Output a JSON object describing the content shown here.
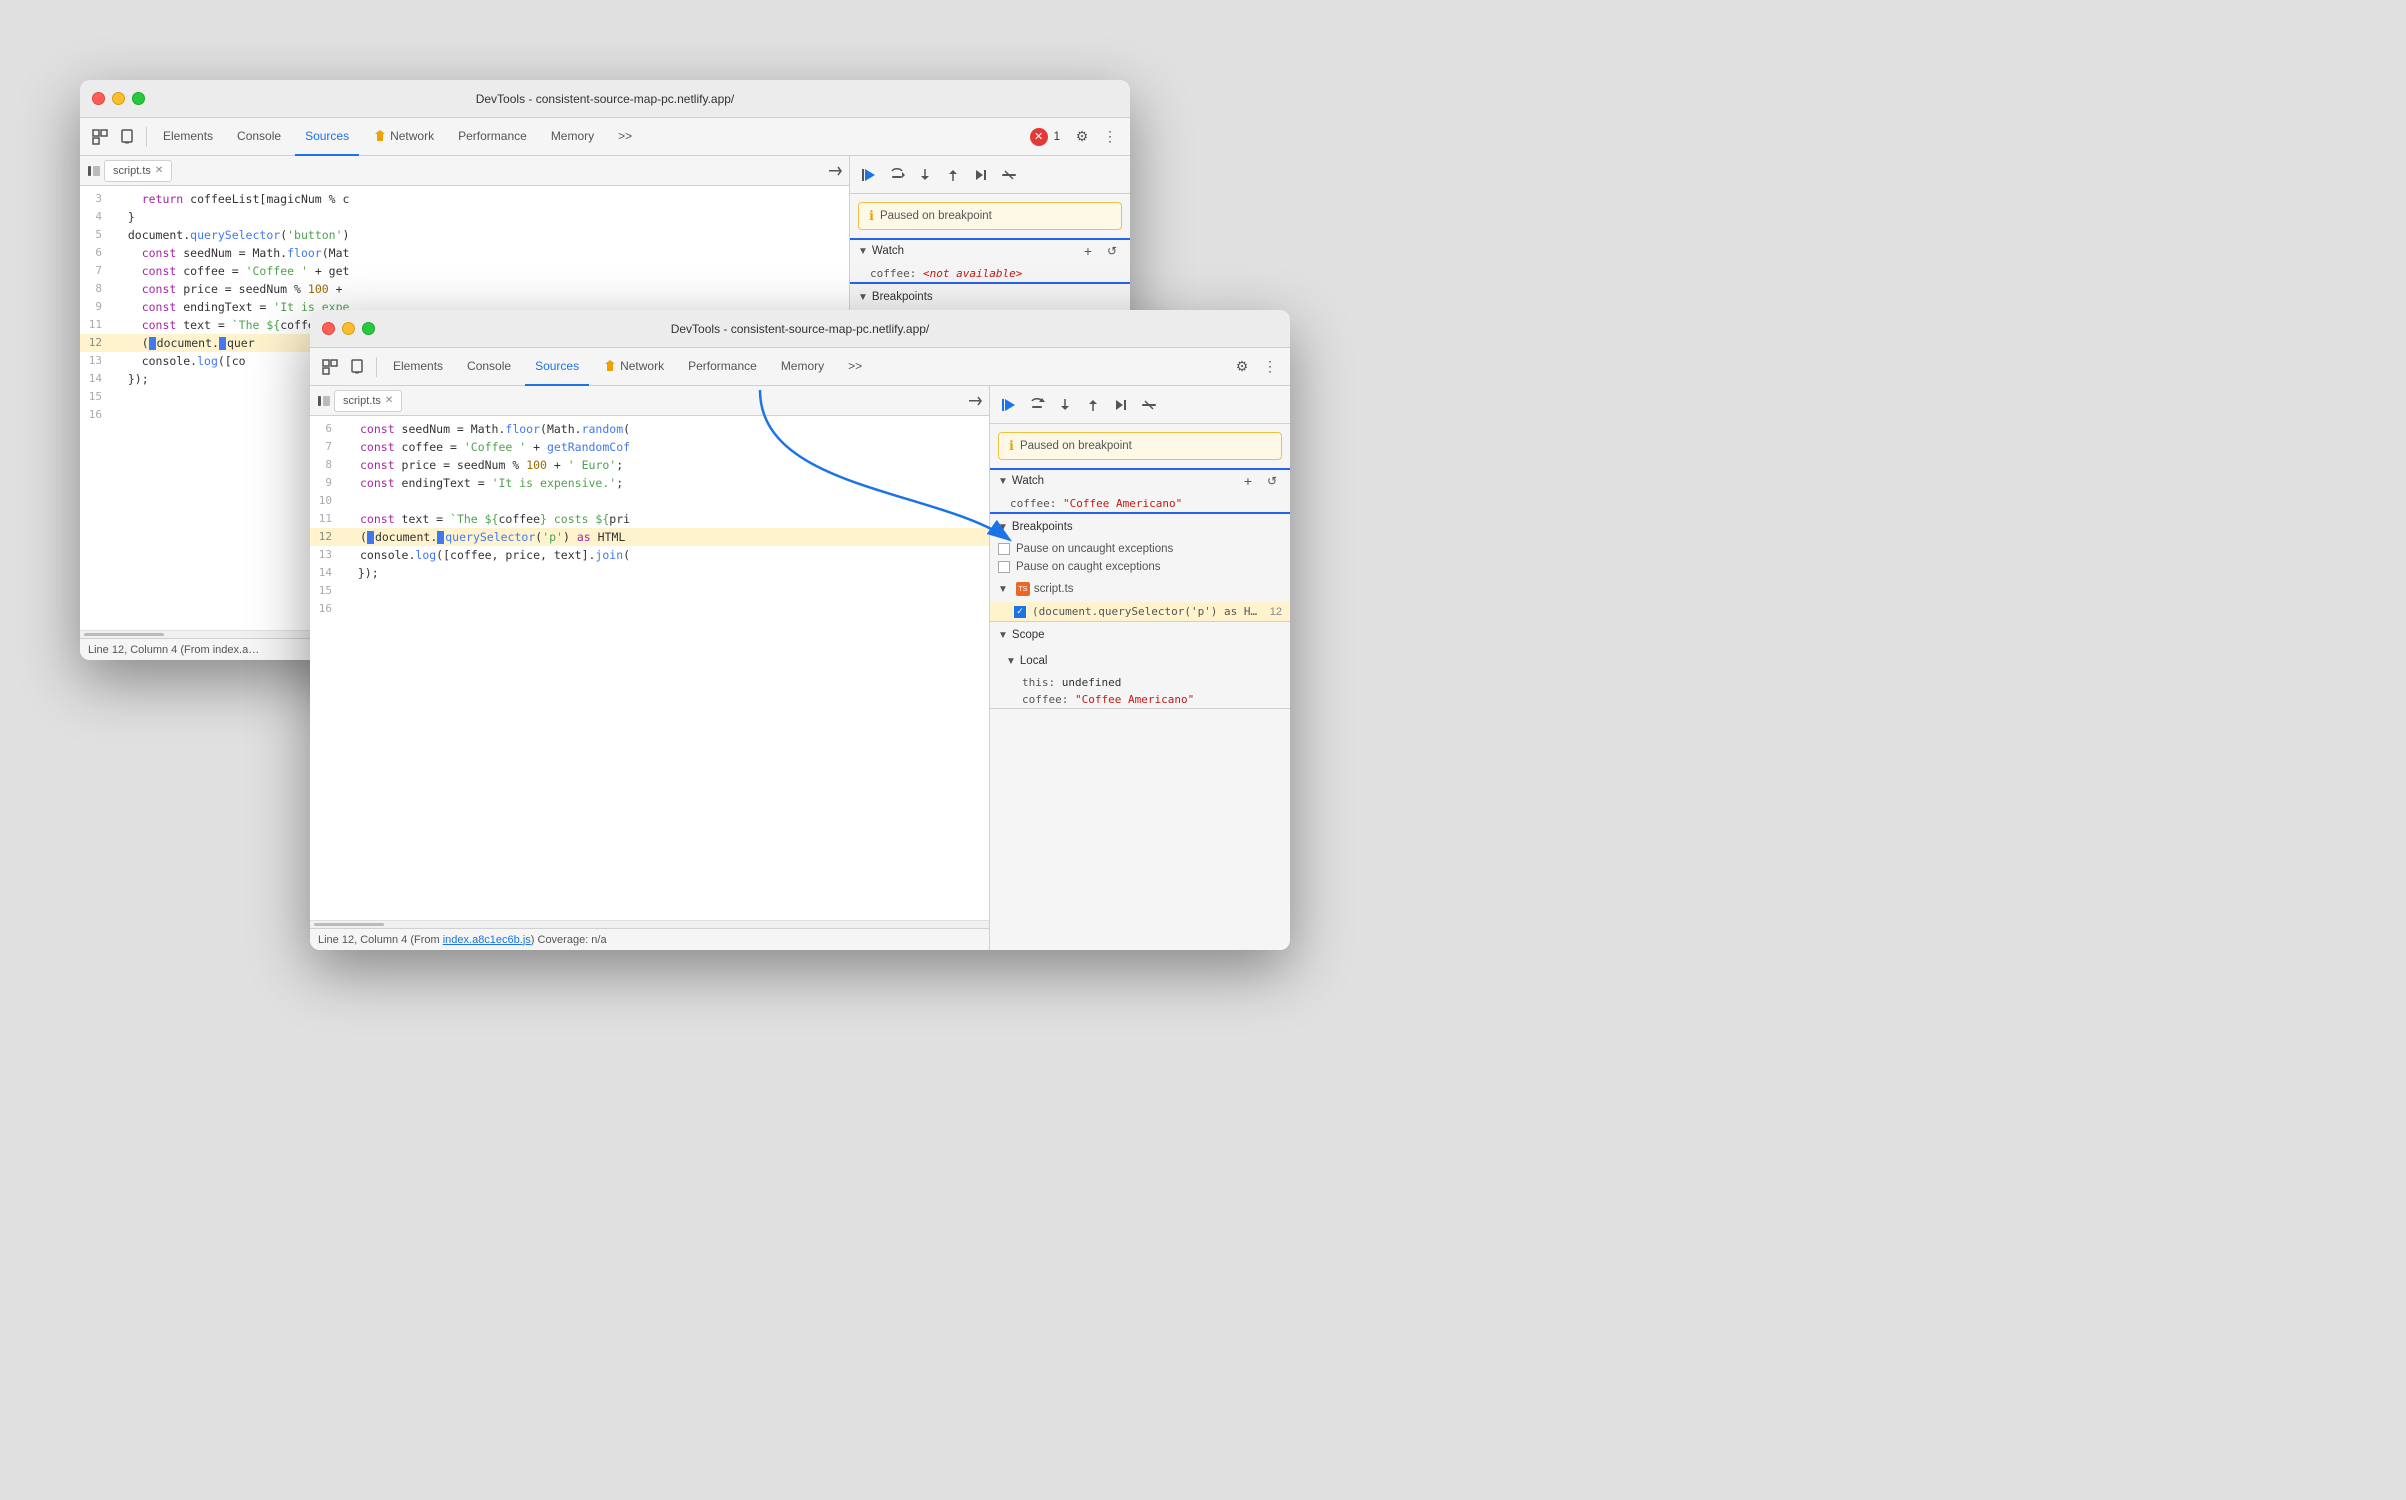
{
  "windows": {
    "back": {
      "title": "DevTools - consistent-source-map-pc.netlify.app/",
      "filename": "script.ts",
      "tabs": [
        "Elements",
        "Console",
        "Sources",
        "Network",
        "Performance",
        "Memory"
      ],
      "activeTab": "Sources",
      "statusBar": "Line 12, Column 4 (From index.a…",
      "pausedText": "Paused on breakpoint",
      "codeLines": [
        {
          "num": 3,
          "content": "    return coffeeList[magicNum % c"
        },
        {
          "num": 4,
          "content": "  }"
        },
        {
          "num": 5,
          "content": "  document.querySelector('button')"
        },
        {
          "num": 6,
          "content": "    const seedNum = Math.floor(Mat"
        },
        {
          "num": 7,
          "content": "    const coffee = 'Coffee ' + get"
        },
        {
          "num": 8,
          "content": "    const price = seedNum % 100 +"
        },
        {
          "num": 9,
          "content": "    const endingText = 'It is expe"
        },
        {
          "num": 11,
          "content": "    const text = `The ${coffee} co"
        },
        {
          "num": 12,
          "content": "    (document.querySelector",
          "highlighted": true
        },
        {
          "num": 13,
          "content": "    console.log([co"
        },
        {
          "num": 14,
          "content": "  });"
        },
        {
          "num": 15,
          "content": ""
        },
        {
          "num": 16,
          "content": ""
        }
      ],
      "watch": {
        "label": "Watch",
        "items": [
          {
            "key": "coffee",
            "value": "<not available>",
            "type": "unavailable"
          }
        ]
      },
      "breakpoints": {
        "label": "Breakpoints",
        "items": []
      }
    },
    "front": {
      "title": "DevTools - consistent-source-map-pc.netlify.app/",
      "filename": "script.ts",
      "tabs": [
        "Elements",
        "Console",
        "Sources",
        "Network",
        "Performance",
        "Memory"
      ],
      "activeTab": "Sources",
      "statusBar": "Line 12, Column 4  (From index.a8c1ec6b.js) Coverage: n/a",
      "statusBarLink": "index.a8c1ec6b.js",
      "pausedText": "Paused on breakpoint",
      "codeLines": [
        {
          "num": 6,
          "content": "    const seedNum = Math.floor(Math.random("
        },
        {
          "num": 7,
          "content": "    const coffee = 'Coffee ' + getRandomCof"
        },
        {
          "num": 8,
          "content": "    const price = seedNum % 100 + ' Euro';"
        },
        {
          "num": 9,
          "content": "    const endingText = 'It is expensive.';"
        },
        {
          "num": 10,
          "content": ""
        },
        {
          "num": 11,
          "content": "    const text = `The ${coffee} costs ${pri"
        },
        {
          "num": 12,
          "content": "    (document.querySelector('p') as HTML",
          "highlighted": true
        },
        {
          "num": 13,
          "content": "    console.log([coffee, price, text].join("
        },
        {
          "num": 14,
          "content": "  });"
        },
        {
          "num": 15,
          "content": ""
        },
        {
          "num": 16,
          "content": ""
        }
      ],
      "watch": {
        "label": "Watch",
        "items": [
          {
            "key": "coffee",
            "value": "\"Coffee Americano\"",
            "type": "value"
          }
        ]
      },
      "breakpoints": {
        "label": "Breakpoints",
        "items": [
          {
            "checked": false,
            "label": "Pause on uncaught exceptions"
          },
          {
            "checked": false,
            "label": "Pause on caught exceptions"
          }
        ],
        "fileBreakpoints": [
          {
            "file": "script.ts",
            "entries": [
              {
                "checked": true,
                "text": "(document.querySelector('p') as HTMLP…",
                "line": 12
              }
            ]
          }
        ]
      },
      "scope": {
        "label": "Scope",
        "local": {
          "label": "Local",
          "items": [
            {
              "key": "this",
              "value": "undefined"
            },
            {
              "key": "coffee",
              "value": "\"Coffee Americano\""
            }
          ]
        }
      }
    }
  },
  "arrow": {
    "label": "annotation-arrow"
  },
  "labels": {
    "watch_back": "Watch",
    "watch_front": "Watch",
    "coffee_unavailable": "coffee: <not available>",
    "coffee_value": "coffee: \"Coffee Americano\"",
    "paused": "Paused on breakpoint",
    "breakpoints": "Breakpoints",
    "scope": "Scope",
    "local": "Local",
    "this_val": "this: undefined",
    "coffee_scope": "coffee: \"Coffee Americano\"",
    "pause_uncaught": "Pause on uncaught exceptions",
    "pause_caught": "Pause on caught exceptions",
    "plus": "+",
    "refresh": "↺"
  }
}
